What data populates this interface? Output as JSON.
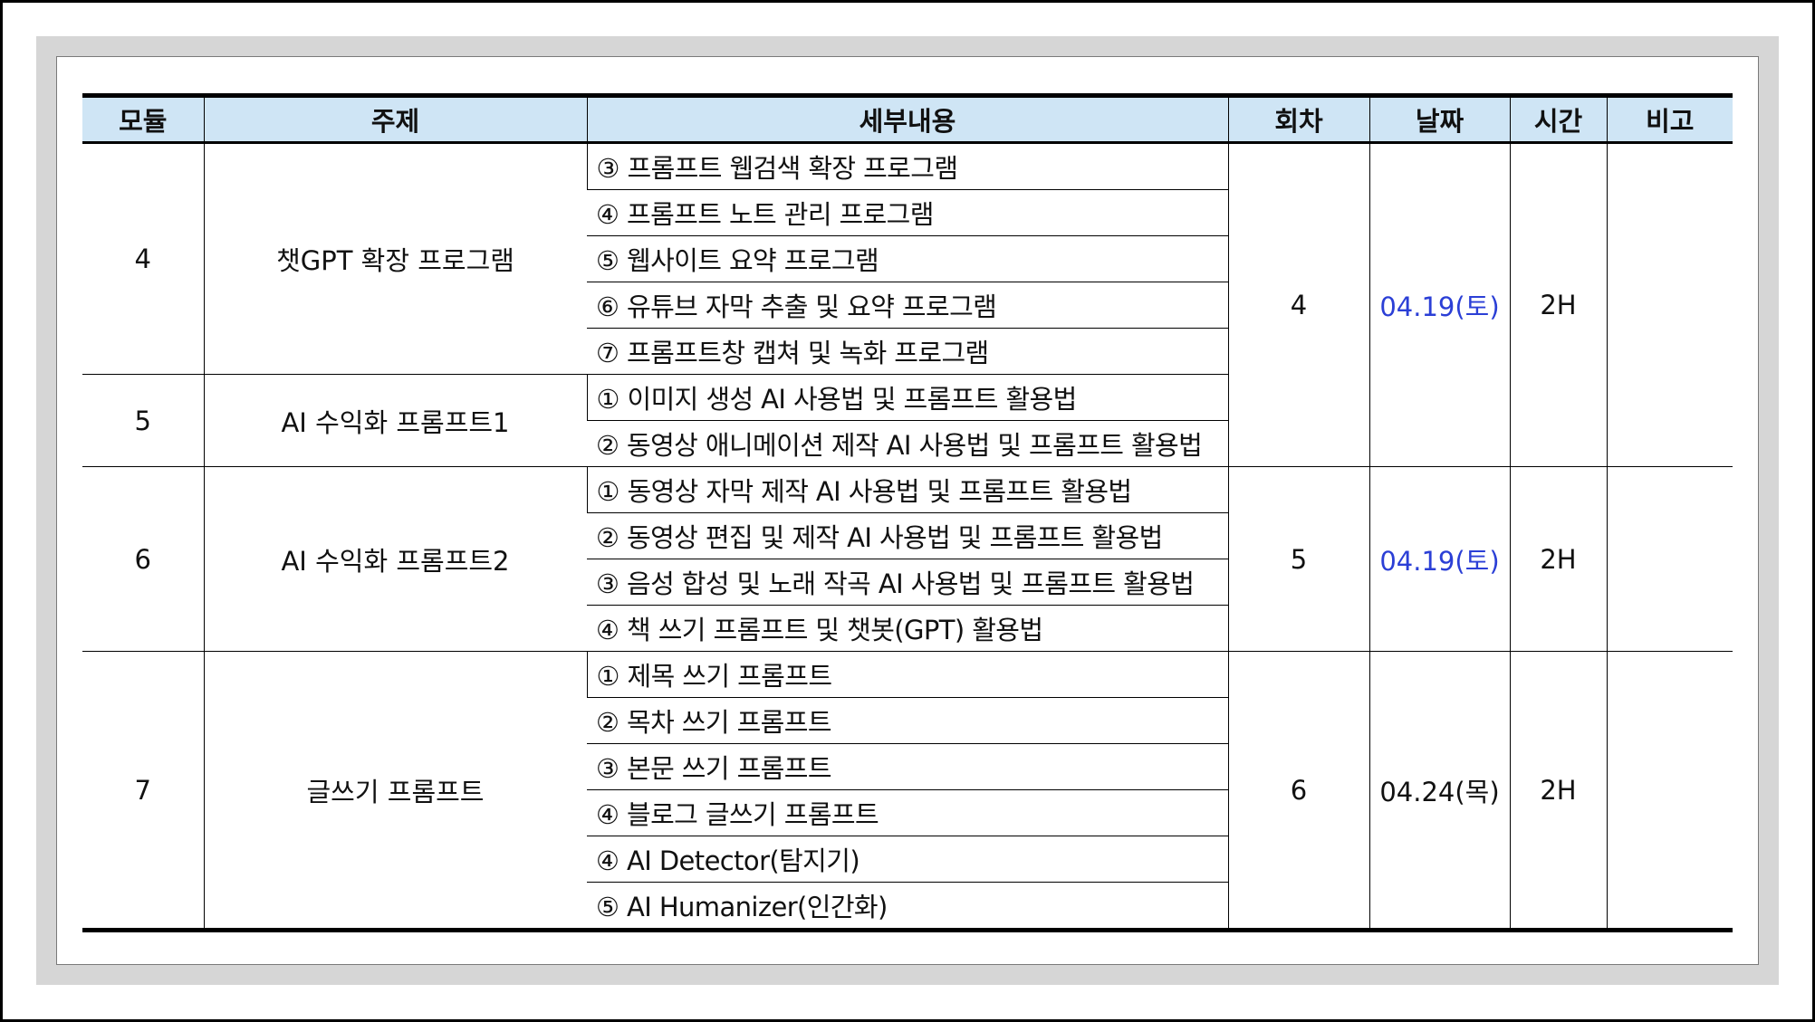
{
  "colors": {
    "header_bg": "#cfe5f5",
    "frame_bg": "#d6d6d6",
    "date_highlight": "#2b3fd6"
  },
  "table": {
    "headers": [
      "모듈",
      "주제",
      "세부내용",
      "회차",
      "날짜",
      "시간",
      "비고"
    ],
    "modules": [
      {
        "module": "4",
        "topic": "챗GPT 확장 프로그램",
        "details": [
          "③ 프롬프트 웹검색 확장 프로그램",
          "④ 프롬프트 노트 관리 프로그램",
          "⑤ 웹사이트 요약 프로그램",
          "⑥ 유튜브 자막 추출 및 요약 프로그램",
          "⑦ 프롬프트창 캡쳐 및 녹화 프로그램"
        ]
      },
      {
        "module": "5",
        "topic": "AI 수익화 프롬프트1",
        "details": [
          "① 이미지 생성 AI 사용법 및 프롬프트 활용법",
          "② 동영상 애니메이션 제작 AI 사용법 및 프롬프트 활용법"
        ]
      },
      {
        "module": "6",
        "topic": "AI 수익화 프롬프트2",
        "details": [
          "① 동영상 자막 제작 AI 사용법 및 프롬프트 활용법",
          "② 동영상 편집 및 제작 AI 사용법 및 프롬프트 활용법",
          "③ 음성 합성 및 노래 작곡 AI 사용법 및 프롬프트 활용법",
          "④ 책 쓰기 프롬프트 및 챗봇(GPT) 활용법"
        ]
      },
      {
        "module": "7",
        "topic": "글쓰기 프롬프트",
        "details": [
          "① 제목 쓰기 프롬프트",
          "② 목차 쓰기 프롬프트",
          "③ 본문 쓰기 프롬프트",
          "④ 블로그 글쓰기 프롬프트",
          "④ AI Detector(탐지기)",
          "⑤ AI Humanizer(인간화)"
        ]
      }
    ],
    "sessions": [
      {
        "session": "4",
        "date": "04.19(토)",
        "time": "2H",
        "note": ""
      },
      {
        "session": "5",
        "date": "04.19(토)",
        "time": "2H",
        "note": ""
      },
      {
        "session": "6",
        "date": "04.24(목)",
        "time": "2H",
        "note": ""
      }
    ]
  }
}
